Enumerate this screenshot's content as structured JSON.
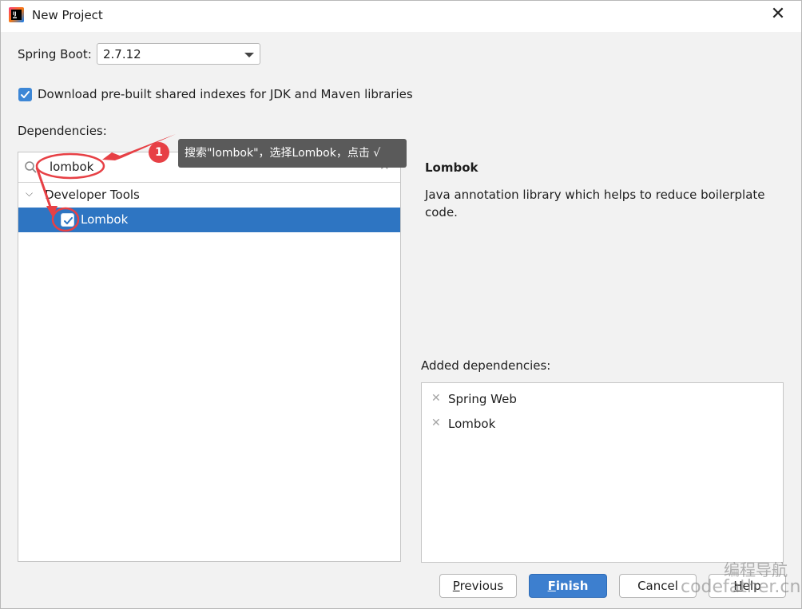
{
  "window": {
    "title": "New Project",
    "close_glyph": "✕",
    "app_icon": "intellij-idea-icon"
  },
  "spring_boot": {
    "label": "Spring Boot:",
    "selected": "2.7.12"
  },
  "download_indexes": {
    "label": "Download pre-built shared indexes for JDK and Maven libraries",
    "checked": true
  },
  "dependencies": {
    "label": "Dependencies:",
    "search_value": "lombok",
    "clear_glyph": "✕",
    "tree": {
      "group_label": "Developer Tools",
      "chevron_glyph": "⌵",
      "item_label": "Lombok",
      "item_checked": true
    }
  },
  "detail": {
    "title": "Lombok",
    "description": "Java annotation library which helps to reduce boilerplate code."
  },
  "added_dependencies": {
    "label": "Added dependencies:",
    "remove_glyph": "✕",
    "items": [
      "Spring Web",
      "Lombok"
    ]
  },
  "buttons": {
    "previous": {
      "mnemonic": "P",
      "rest": "revious"
    },
    "finish": {
      "mnemonic": "F",
      "rest": "inish"
    },
    "cancel": {
      "label": "Cancel"
    },
    "help": {
      "mnemonic": "H",
      "rest": "elp"
    }
  },
  "annotation": {
    "marker": "1",
    "text": "搜索\"lombok\"，选择Lombok，点击 √",
    "color": "#e74045"
  },
  "watermark": {
    "line1": "编程导航",
    "line2": "codefather.cn"
  },
  "colors": {
    "selection": "#2e75c2",
    "primary_button": "#3d7fcf",
    "checkbox": "#3d87d6"
  }
}
